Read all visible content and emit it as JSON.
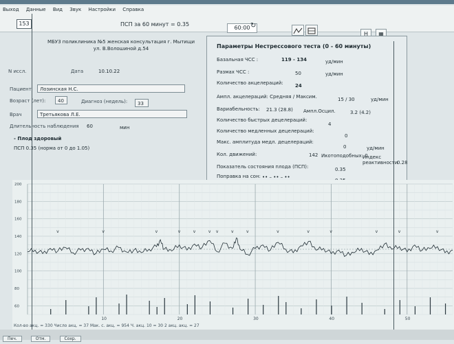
{
  "menu": [
    "Выход",
    "Данные",
    "Вид",
    "Звук",
    "Настройки",
    "Справка"
  ],
  "toolbar": {
    "record_number": "153",
    "psp_label": "ПСП за 60 минут = 0.35",
    "time": "60:00",
    "h_label": "H"
  },
  "patient": {
    "clinic_lines": [
      "МБУЗ поликлиника №5 женская консультация г. Мытищи",
      "ул. В.Волошиной д.54"
    ],
    "n_issl_label": "N иссл.",
    "date_label": "Дата",
    "date_value": "10.10.22",
    "patient_label": "Пациент",
    "patient_value": "Лозинская Н.С.",
    "age_label": "Возраст (лет):",
    "age_value": "40",
    "term_label": "Диагноз (недель):",
    "term_value": "33",
    "doctor_label": "Врач",
    "doctor_value": "Третьякова Л.Е.",
    "duration_label": "Длительность наблюдения",
    "duration_value": "60",
    "duration_unit": "мин",
    "fetus_status": "- Плод здоровый",
    "psp_norm": "ПСП 0.35 (норма от 0 до 1.05)"
  },
  "params": {
    "title": "Параметры Нестрессового теста (0 - 60 минуты)",
    "rows": [
      {
        "label": "Базальная ЧСС :",
        "value": "119 - 134",
        "unit": "уд/мин"
      },
      {
        "label": "Размах ЧСС :",
        "value": "50",
        "unit": "уд/мин"
      },
      {
        "label": "Количество акцелераций:",
        "value": "24",
        "unit": ""
      },
      {
        "label": "Ампл. акцелераций: Средняя / Максим.",
        "value": "15  /  30",
        "unit": "уд/мин"
      },
      {
        "label": "Вариабельность:",
        "value": "21.3 (28.8)",
        "unit": ""
      },
      {
        "label": "Количество быстрых децелераций:",
        "value": "4",
        "unit": ""
      },
      {
        "label": "Количество медленных децелераций:",
        "value": "0",
        "unit": ""
      },
      {
        "label": "Макс. амплитуда медл. децелераций:",
        "value": "0",
        "unit": "уд/мин"
      },
      {
        "label": "Кол. движений:",
        "value": "142",
        "unit": ""
      },
      {
        "label": "Показатель состояния плода (ПСП):",
        "value": "0.35",
        "unit": ""
      },
      {
        "label": "Поправка на сон:",
        "value": "0.35",
        "unit": ""
      }
    ],
    "amp_osc_label": "Ампл.Осцил.",
    "amp_osc_value": "3.2 (4.2)",
    "hiccups_label": "Икотоподобных: 0",
    "reactivity_label": "Индекс реактивности",
    "reactivity_value": "0.28",
    "sleep_marks": "•• – •• – ••"
  },
  "chart_data": {
    "type": "line",
    "y_ticks": [
      "200",
      "180",
      "160",
      "140",
      "120",
      "100",
      "80",
      "60"
    ],
    "x_ticks": [
      "10",
      "20",
      "30",
      "40",
      "50"
    ],
    "x_range": [
      0,
      56
    ],
    "ylim": [
      50,
      200
    ],
    "baseline": 125,
    "heart_rate": [
      [
        0,
        122
      ],
      [
        1,
        124
      ],
      [
        2,
        120
      ],
      [
        3,
        126
      ],
      [
        4,
        123
      ],
      [
        5,
        127
      ],
      [
        6,
        121
      ],
      [
        7,
        124
      ],
      [
        8,
        126
      ],
      [
        9,
        120
      ],
      [
        10,
        125
      ],
      [
        11,
        123
      ],
      [
        12,
        127
      ],
      [
        13,
        122
      ],
      [
        14,
        124
      ],
      [
        15,
        121
      ],
      [
        16,
        125
      ],
      [
        17,
        128
      ],
      [
        17.5,
        136
      ],
      [
        18,
        125
      ],
      [
        19,
        123
      ],
      [
        20,
        130
      ],
      [
        21,
        124
      ],
      [
        22,
        131
      ],
      [
        23,
        127
      ],
      [
        24,
        135
      ],
      [
        25,
        122
      ],
      [
        26,
        132
      ],
      [
        27,
        126
      ],
      [
        27.5,
        138
      ],
      [
        28,
        125
      ],
      [
        29,
        119
      ],
      [
        30,
        126
      ],
      [
        31,
        130
      ],
      [
        32,
        124
      ],
      [
        33,
        133
      ],
      [
        34,
        125
      ],
      [
        35,
        121
      ],
      [
        36,
        129
      ],
      [
        37,
        134
      ],
      [
        38,
        124
      ],
      [
        39,
        126
      ],
      [
        40,
        120
      ],
      [
        41,
        124
      ],
      [
        42,
        118
      ],
      [
        43,
        121
      ],
      [
        44,
        126
      ],
      [
        45,
        119
      ],
      [
        46,
        124
      ],
      [
        47,
        131
      ],
      [
        48,
        125
      ],
      [
        49,
        128
      ],
      [
        50,
        122
      ],
      [
        51,
        130
      ],
      [
        52,
        124
      ],
      [
        53,
        126
      ],
      [
        54,
        128
      ],
      [
        55,
        121
      ],
      [
        56,
        124
      ]
    ],
    "movement_bars": [
      3,
      5,
      8,
      9,
      12,
      13,
      16,
      17,
      18,
      21,
      22,
      24,
      27,
      29,
      31,
      33,
      34,
      36,
      38,
      40,
      42,
      44,
      47,
      49,
      51,
      53,
      55
    ],
    "accel_marks": [
      4,
      10,
      17,
      20,
      22,
      24,
      25,
      27,
      29,
      33,
      37,
      40,
      46,
      49,
      54
    ]
  },
  "status_line": "Кол-во акц. = 330   Число акц. = 37   Мак. с. акц. = 954   Ч. акц. 10 = 30   2 акц. акц. = 27",
  "bottom_buttons": [
    "Печ.",
    "Отм.",
    "Сохр."
  ]
}
